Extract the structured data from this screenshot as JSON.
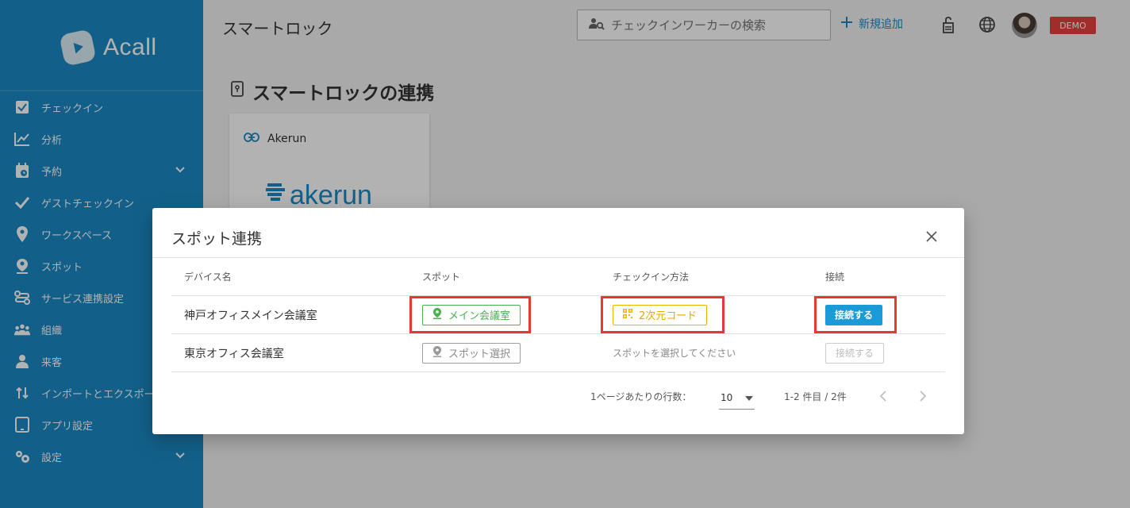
{
  "app": {
    "logo_text": "Acall"
  },
  "sidebar": {
    "items": [
      {
        "label": "チェックイン",
        "icon": "checkbox-icon",
        "chevron": false
      },
      {
        "label": "分析",
        "icon": "chart-line-icon",
        "chevron": false
      },
      {
        "label": "予約",
        "icon": "calendar-clock-icon",
        "chevron": true
      },
      {
        "label": "ゲストチェックイン",
        "icon": "check-icon",
        "chevron": false
      },
      {
        "label": "ワークスペース",
        "icon": "map-pin-icon",
        "chevron": false
      },
      {
        "label": "スポット",
        "icon": "location-person-icon",
        "chevron": false
      },
      {
        "label": "サービス連携設定",
        "icon": "integration-icon",
        "chevron": false
      },
      {
        "label": "組織",
        "icon": "group-icon",
        "chevron": false
      },
      {
        "label": "来客",
        "icon": "visitor-icon",
        "chevron": false
      },
      {
        "label": "インポートとエクスポート",
        "icon": "import-export-icon",
        "chevron": false
      },
      {
        "label": "アプリ設定",
        "icon": "tablet-icon",
        "chevron": false
      },
      {
        "label": "設定",
        "icon": "gears-icon",
        "chevron": true
      }
    ]
  },
  "header": {
    "title": "スマートロック",
    "search_placeholder": "チェックインワーカーの検索",
    "add_new_label": "新規追加",
    "badge": "DEMO"
  },
  "page": {
    "section_title": "スマートロックの連携",
    "card_title": "Akerun",
    "card_logo_text": "akerun"
  },
  "modal": {
    "title": "スポット連携",
    "columns": [
      "デバイス名",
      "スポット",
      "チェックイン方法",
      "接続"
    ],
    "rows": [
      {
        "device": "神戸オフィスメイン会議室",
        "spot": "メイン会議室",
        "checkin_method": "2次元コード",
        "connect": "接続する"
      },
      {
        "device": "東京オフィス会議室",
        "spot": "スポット選択",
        "checkin_method": "スポットを選択してください",
        "connect": "接続する"
      }
    ],
    "pagination": {
      "rows_per_page_label": "1ページあたりの行数：",
      "rows_per_page": "10",
      "range": "1-2 件目 / 2件"
    }
  },
  "colors": {
    "sidebar": "#1a8ac4",
    "primary": "#1a9ad6",
    "highlight": "#e53935",
    "demo_badge": "#e74040",
    "spot_green": "#4caf50",
    "qr_orange": "#f0b400"
  }
}
